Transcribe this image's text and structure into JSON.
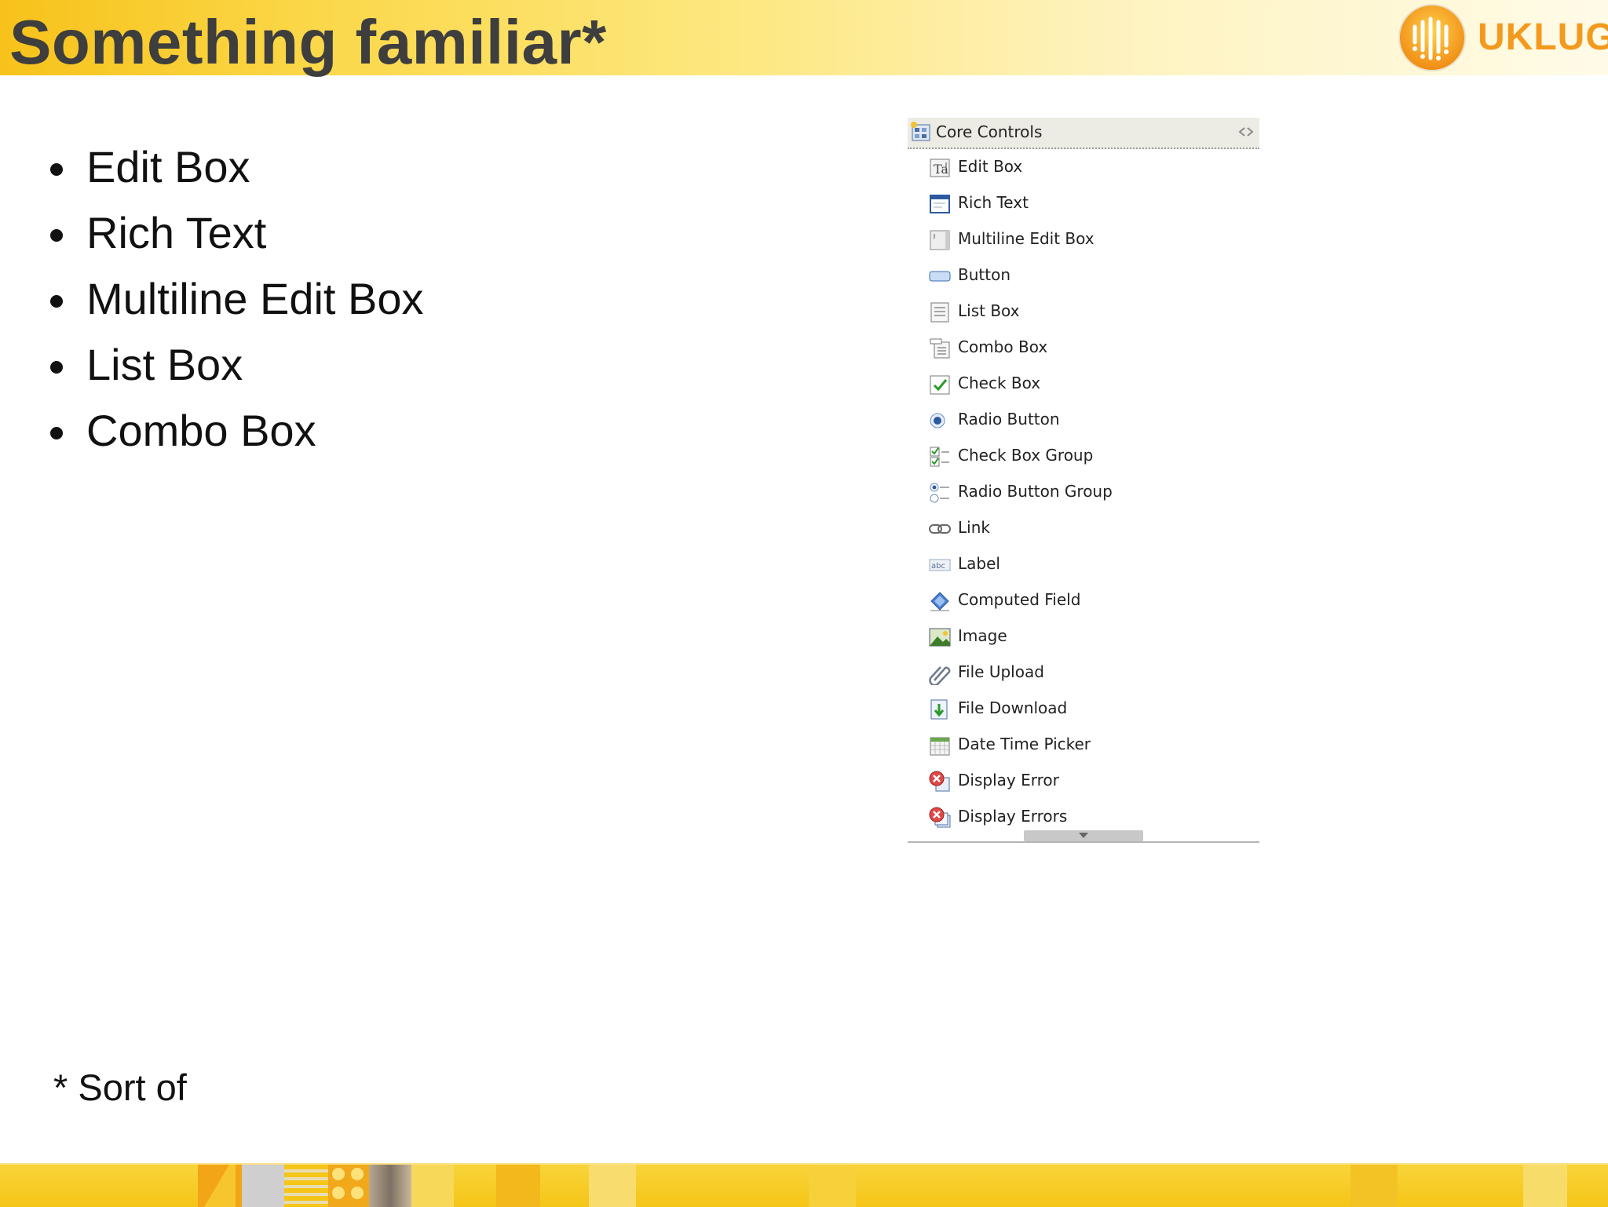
{
  "slide": {
    "title": "Something familiar*",
    "logo_text": "UKLUG",
    "bullets": [
      "Edit Box",
      "Rich Text",
      "Multiline Edit Box",
      "List Box",
      "Combo Box"
    ],
    "footnote": "* Sort of"
  },
  "palette": {
    "title": "Core Controls",
    "items": [
      {
        "label": "Edit Box",
        "icon": "edit-box-icon"
      },
      {
        "label": "Rich Text",
        "icon": "rich-text-icon"
      },
      {
        "label": "Multiline Edit Box",
        "icon": "multiline-edit-box-icon"
      },
      {
        "label": "Button",
        "icon": "button-icon"
      },
      {
        "label": "List Box",
        "icon": "list-box-icon"
      },
      {
        "label": "Combo Box",
        "icon": "combo-box-icon"
      },
      {
        "label": "Check Box",
        "icon": "check-box-icon"
      },
      {
        "label": "Radio Button",
        "icon": "radio-button-icon"
      },
      {
        "label": "Check Box Group",
        "icon": "check-box-group-icon"
      },
      {
        "label": "Radio Button Group",
        "icon": "radio-button-group-icon"
      },
      {
        "label": "Link",
        "icon": "link-icon"
      },
      {
        "label": "Label",
        "icon": "label-icon"
      },
      {
        "label": "Computed Field",
        "icon": "computed-field-icon"
      },
      {
        "label": "Image",
        "icon": "image-icon"
      },
      {
        "label": "File Upload",
        "icon": "file-upload-icon"
      },
      {
        "label": "File Download",
        "icon": "file-download-icon"
      },
      {
        "label": "Date Time Picker",
        "icon": "date-time-picker-icon"
      },
      {
        "label": "Display Error",
        "icon": "display-error-icon"
      },
      {
        "label": "Display Errors",
        "icon": "display-errors-icon"
      }
    ]
  },
  "colors": {
    "header_accent": "#f7c21a",
    "logo_orange": "#f39a1e",
    "footer_yellow": "#f5c518"
  }
}
